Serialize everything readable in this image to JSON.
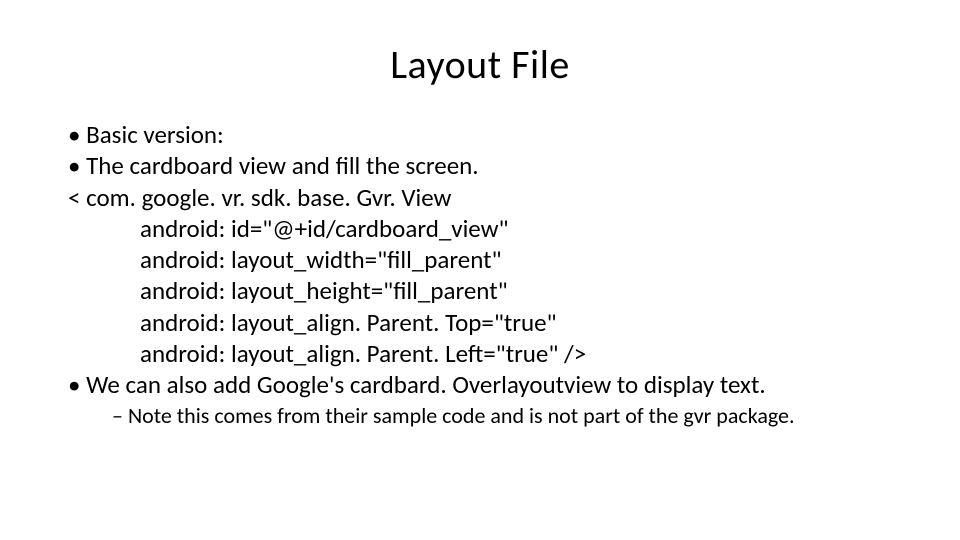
{
  "title": "Layout File",
  "bullets": {
    "b1": "Basic version:",
    "b2": "The cardboard view and fill the screen.",
    "code0": "< com. google. vr. sdk. base. Gvr. View",
    "code1": "android: id=\"@+id/cardboard_view\"",
    "code2": "android: layout_width=\"fill_parent\"",
    "code3": "android: layout_height=\"fill_parent\"",
    "code4": "android: layout_align. Parent. Top=\"true\"",
    "code5": "android: layout_align. Parent. Left=\"true\" />",
    "b3": "We can also add Google's cardbard. Overlayoutview to display text.",
    "sub1": "Note this comes from their sample code and is not part of the gvr package."
  }
}
